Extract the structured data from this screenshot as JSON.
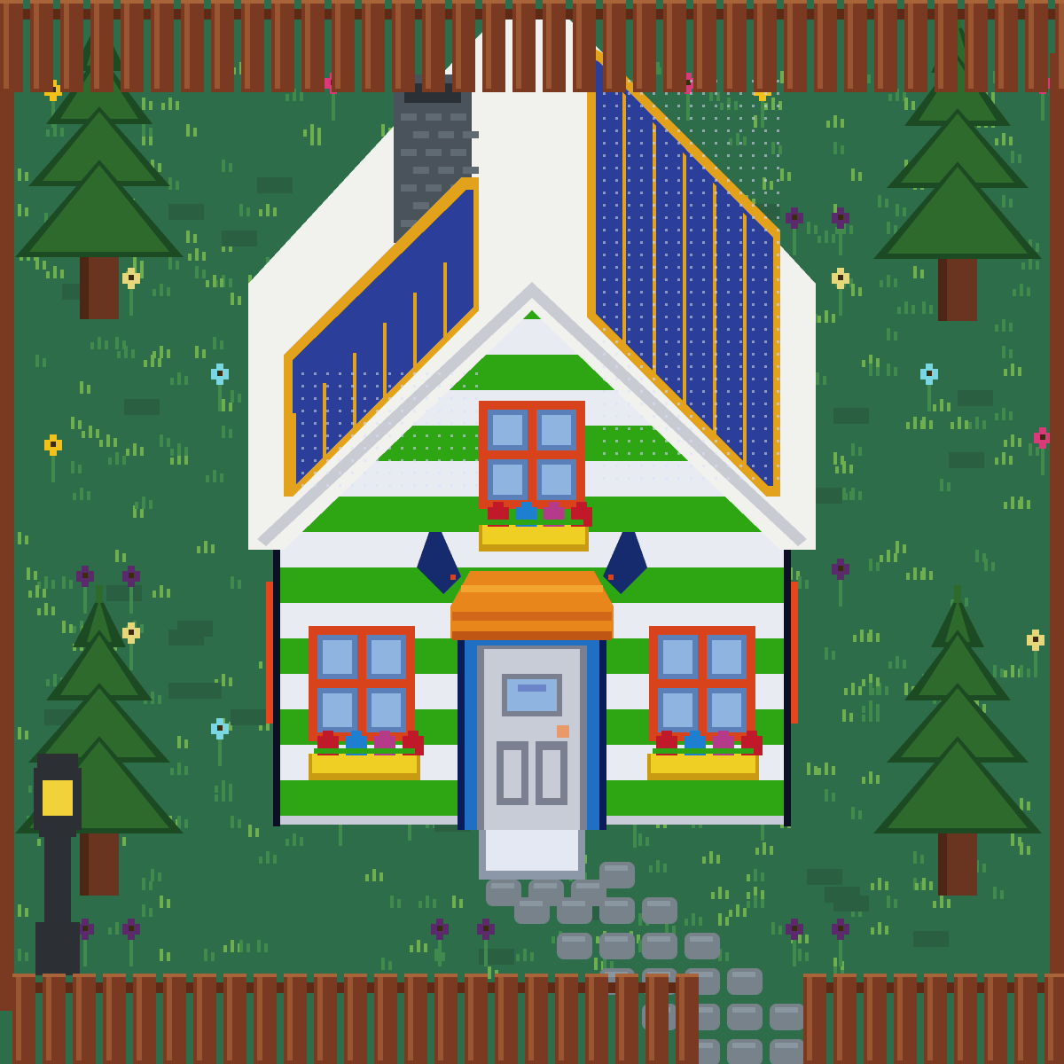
{
  "scene": {
    "kind": "pixel-art cottage yard",
    "palette": {
      "grass": "#2e6d4a",
      "grass_tuft_light": "#6fae4f",
      "grass_tuft_dark": "#3f8a4c",
      "fence": "#7a3a22",
      "fence_highlight": "#9a5630",
      "roof_white": "#f1f1ee",
      "roof_shade": "#c9cbd2",
      "solar_blue": "#2b3f9a",
      "solar_frame": "#e3a21c",
      "stripe_green": "#2ea614",
      "stripe_white": "#e8ebf2",
      "chimney": "#4a535b",
      "window_frame": "#d9431c",
      "window_glass": "#8fb4e0",
      "flower_box": "#f0cf25",
      "awning": "#e8861c",
      "door_frame": "#1f6fc4",
      "door": "#c8ccd6",
      "path_stone": "#77828a",
      "tree_dark": "#1c4a22",
      "tree_mid": "#2d6a2c",
      "tree_trunk": "#6a3520",
      "lamp_post": "#2c2f33",
      "lamp_light": "#f2d23b"
    },
    "elements": {
      "house": "striped-cottage",
      "roof": "solar-panel-roof",
      "chimney": "brick-chimney",
      "door": "front-door",
      "windows": [
        "attic-window",
        "left-window",
        "right-window"
      ],
      "flower_boxes": [
        "attic-flower-box",
        "left-flower-box",
        "right-flower-box"
      ],
      "trees": [
        "pine-tree-top-left",
        "pine-tree-top-right",
        "pine-tree-bottom-left",
        "pine-tree-bottom-right"
      ],
      "lamp": "street-lamp",
      "path": "stone-path",
      "fence_gate": "fence-gate-opening"
    }
  }
}
